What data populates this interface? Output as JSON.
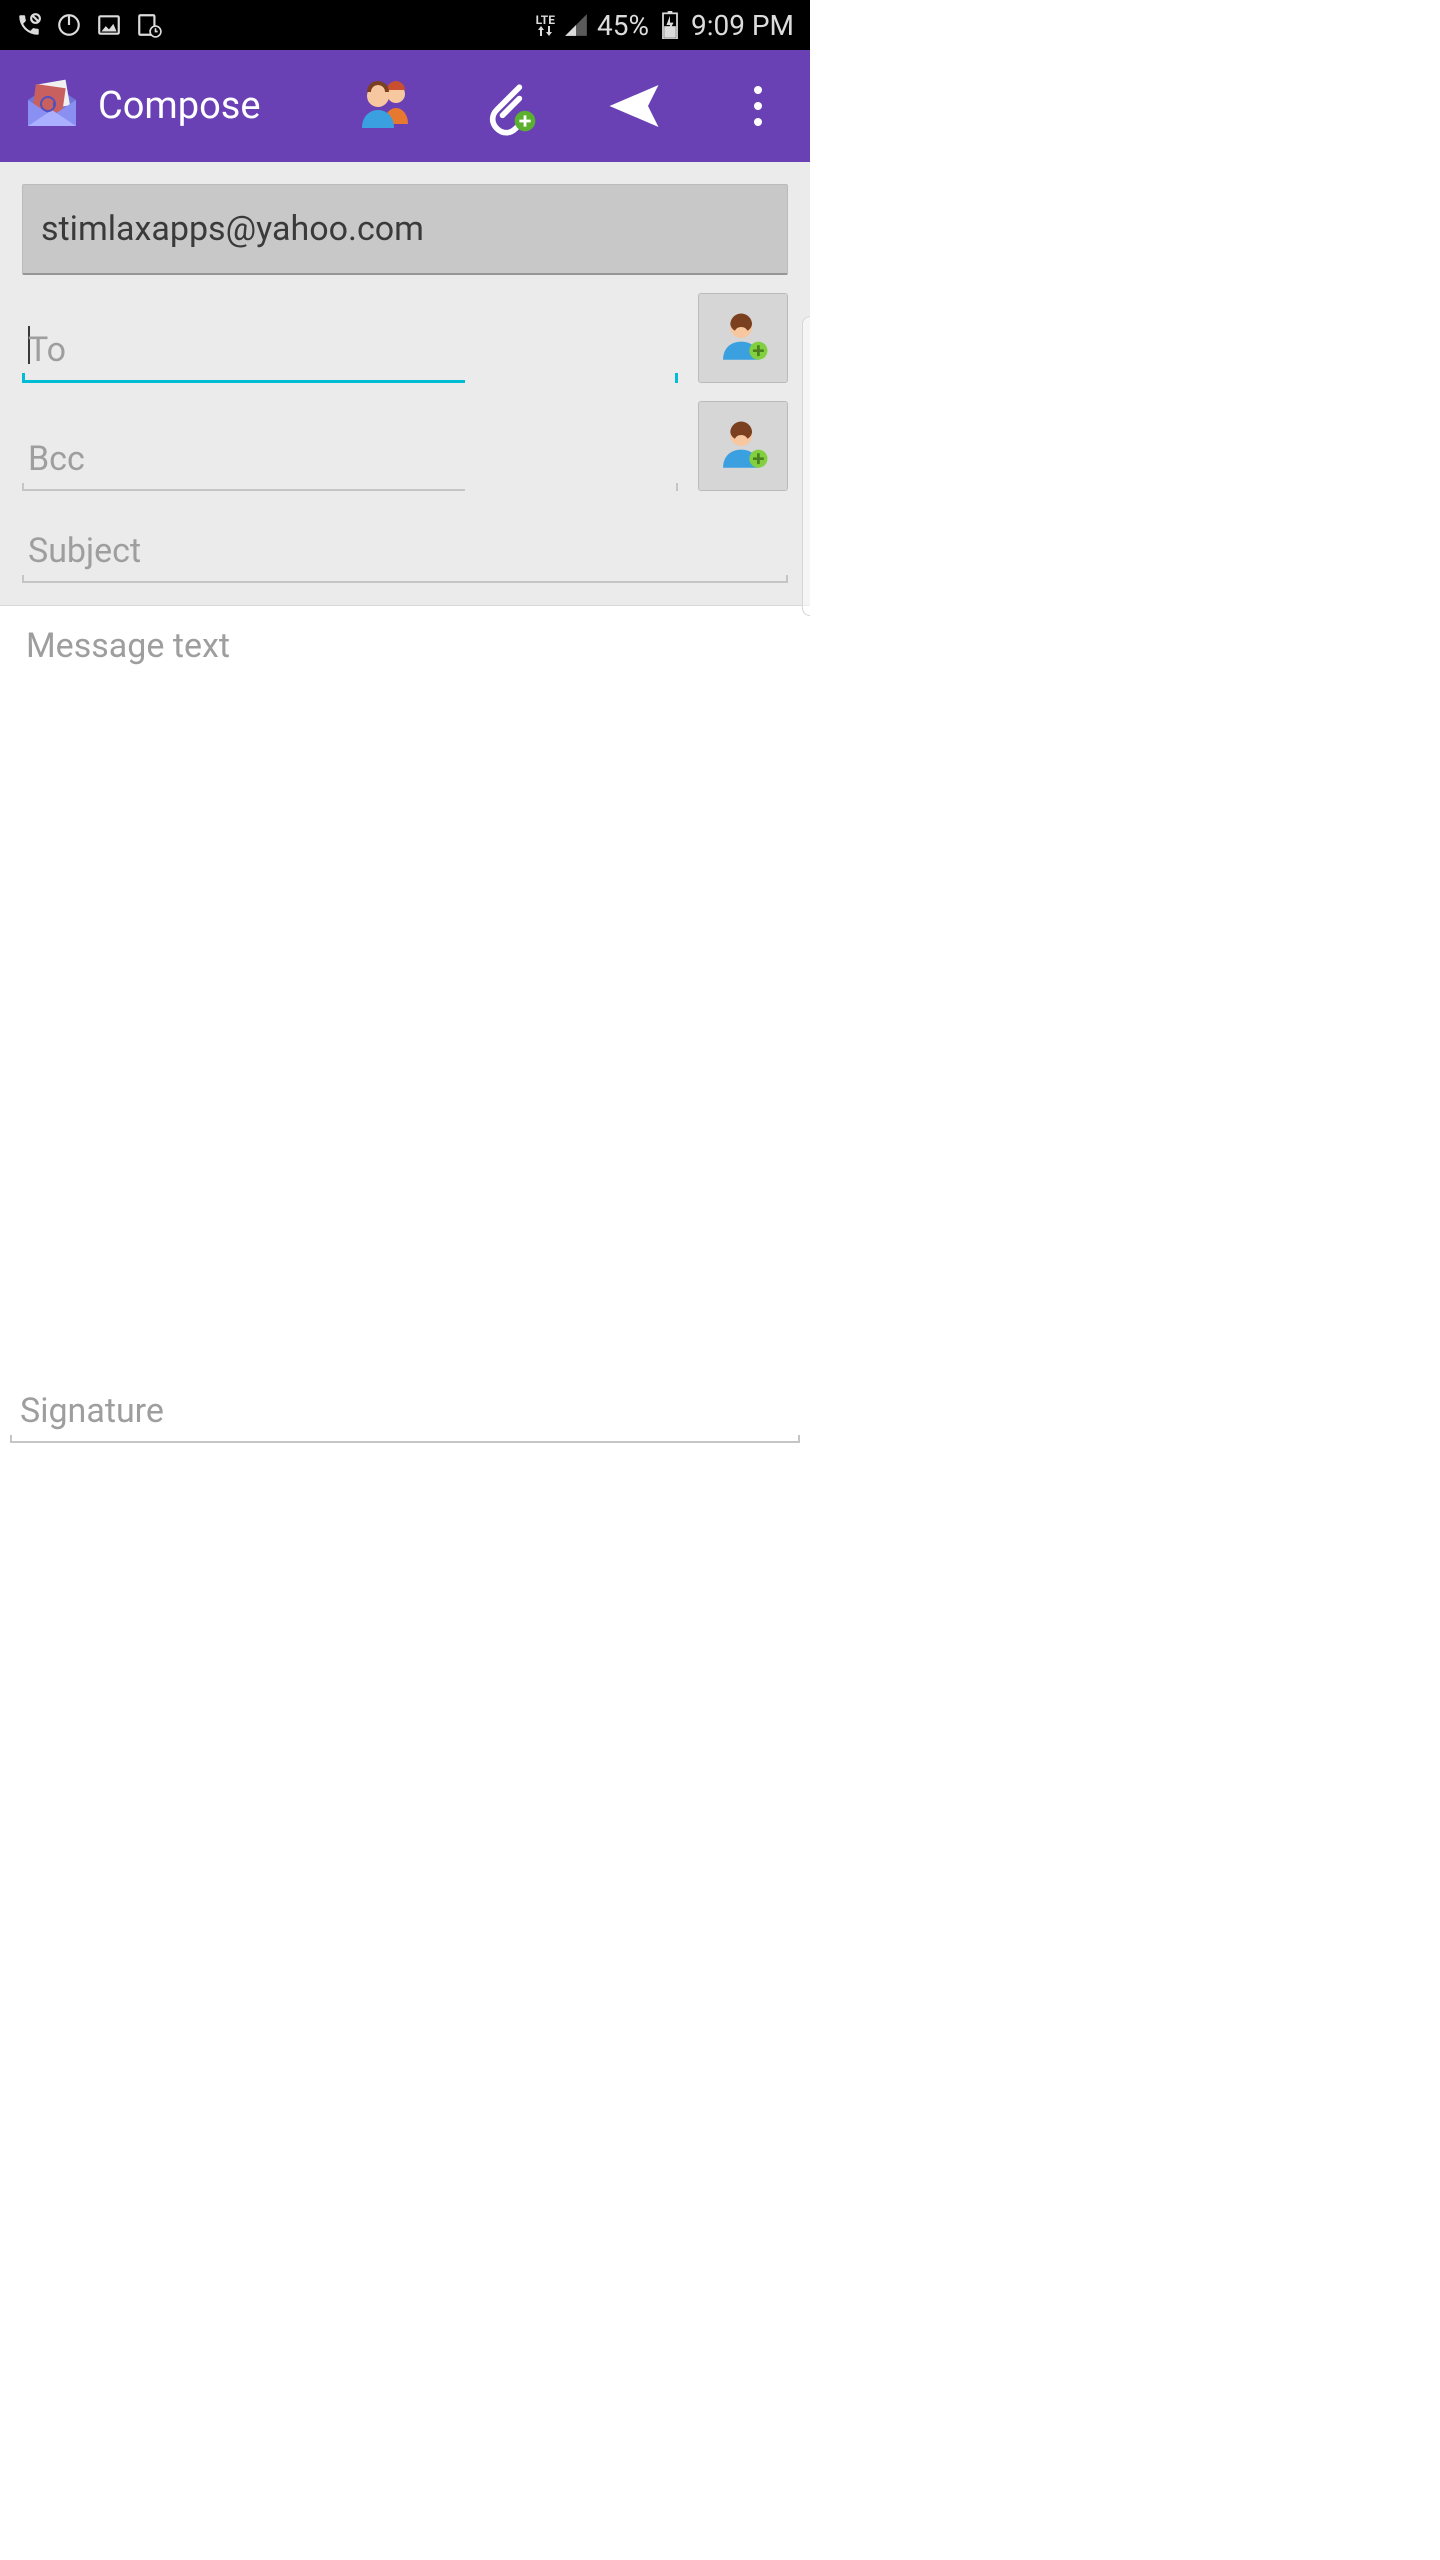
{
  "status": {
    "battery": "45%",
    "time": "9:09 PM",
    "network": "LTE"
  },
  "appbar": {
    "title": "Compose"
  },
  "from": {
    "email": "stimlaxapps@yahoo.com"
  },
  "fields": {
    "to_placeholder": "To",
    "bcc_placeholder": "Bcc",
    "subject_placeholder": "Subject",
    "message_placeholder": "Message text",
    "signature_placeholder": "Signature"
  },
  "colors": {
    "primary": "#6A40B5",
    "accent": "#00bcd4"
  }
}
